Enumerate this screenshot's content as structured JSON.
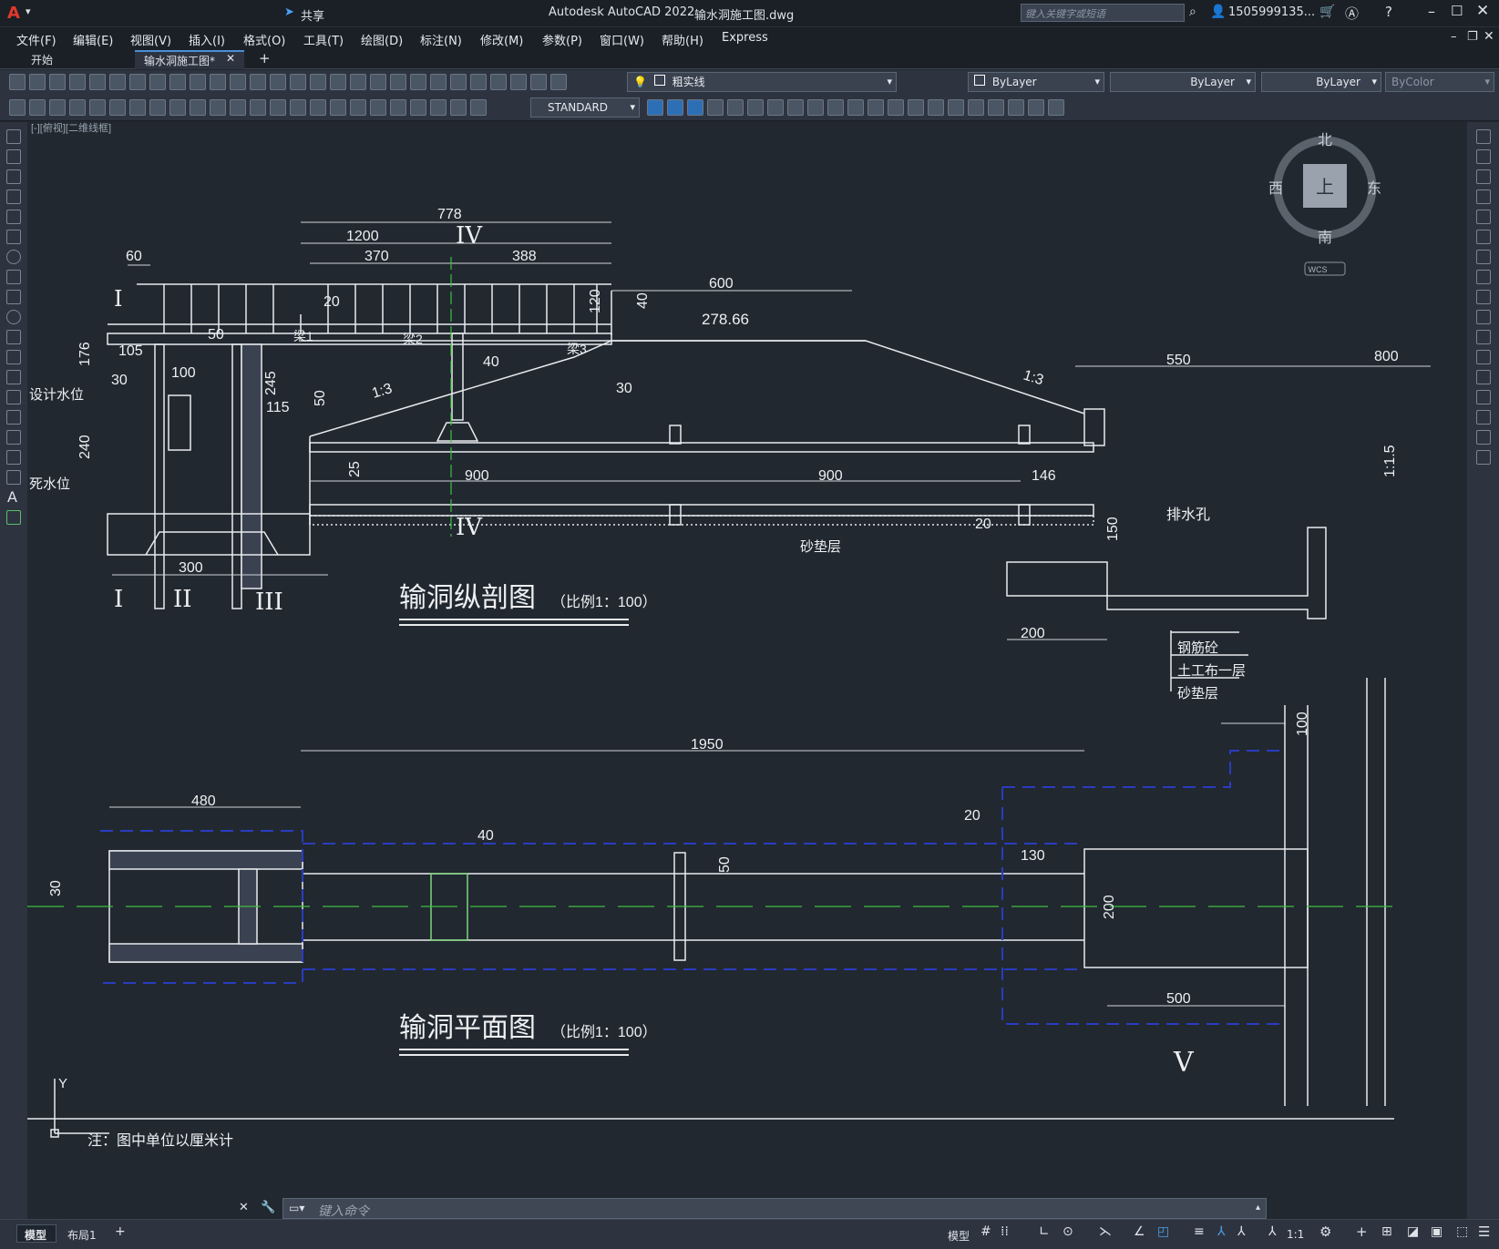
{
  "titlebar": {
    "app_title": "Autodesk AutoCAD 2022",
    "file_name": "输水洞施工图.dwg",
    "share_label": "共享",
    "search_placeholder": "键入关键字或短语",
    "user_label": "1505999135..."
  },
  "menu": [
    "文件(F)",
    "编辑(E)",
    "视图(V)",
    "插入(I)",
    "格式(O)",
    "工具(T)",
    "绘图(D)",
    "标注(N)",
    "修改(M)",
    "参数(P)",
    "窗口(W)",
    "帮助(H)",
    "Express"
  ],
  "tabs": {
    "start": "开始",
    "active": "输水洞施工图*",
    "add": "+"
  },
  "toolbar": {
    "layer_name": "粗实线",
    "color": "ByLayer",
    "linetype": "ByLayer",
    "lineweight": "ByLayer",
    "plotstyle": "ByColor",
    "textstyle": "STANDARD"
  },
  "viewport_label": "[-][俯视][二维线框]",
  "viewcube": {
    "north": "北",
    "south": "南",
    "east": "东",
    "west": "西",
    "top": "上",
    "wcs": "WCS"
  },
  "drawing": {
    "section_title": "输洞纵剖图",
    "section_scale": "（比例1：100）",
    "plan_title": "输洞平面图",
    "plan_scale": "（比例1：100）",
    "note": "注：图中单位以厘米计",
    "design_water": "设计水位",
    "dead_water": "死水位",
    "elevation": "278.66",
    "drain_hole": "排水孔",
    "sand_layer": "砂垫层",
    "legend": [
      "钢筋砼",
      "土工布一层",
      "砂垫层"
    ],
    "beams": [
      "梁1",
      "梁2",
      "梁3"
    ],
    "slope_a": "1:3",
    "slope_b": "1:1.5",
    "roman": [
      "I",
      "II",
      "III",
      "IV",
      "V"
    ],
    "dims_section": [
      "778",
      "1200",
      "370",
      "388",
      "60",
      "600",
      "40",
      "120",
      "20",
      "50",
      "105",
      "30",
      "176",
      "240",
      "100",
      "245",
      "115",
      "30",
      "40",
      "50",
      "900",
      "900",
      "146",
      "550",
      "800",
      "300",
      "25",
      "200",
      "150",
      "20"
    ],
    "dims_plan": [
      "1950",
      "480",
      "40",
      "50",
      "130",
      "200",
      "500",
      "100",
      "20",
      "30"
    ],
    "ucs_y": "Y"
  },
  "command": {
    "placeholder": "键入命令"
  },
  "status": {
    "model_tab": "模型",
    "layout_tab": "布局1",
    "model_label": "模型",
    "scale": "1:1"
  }
}
